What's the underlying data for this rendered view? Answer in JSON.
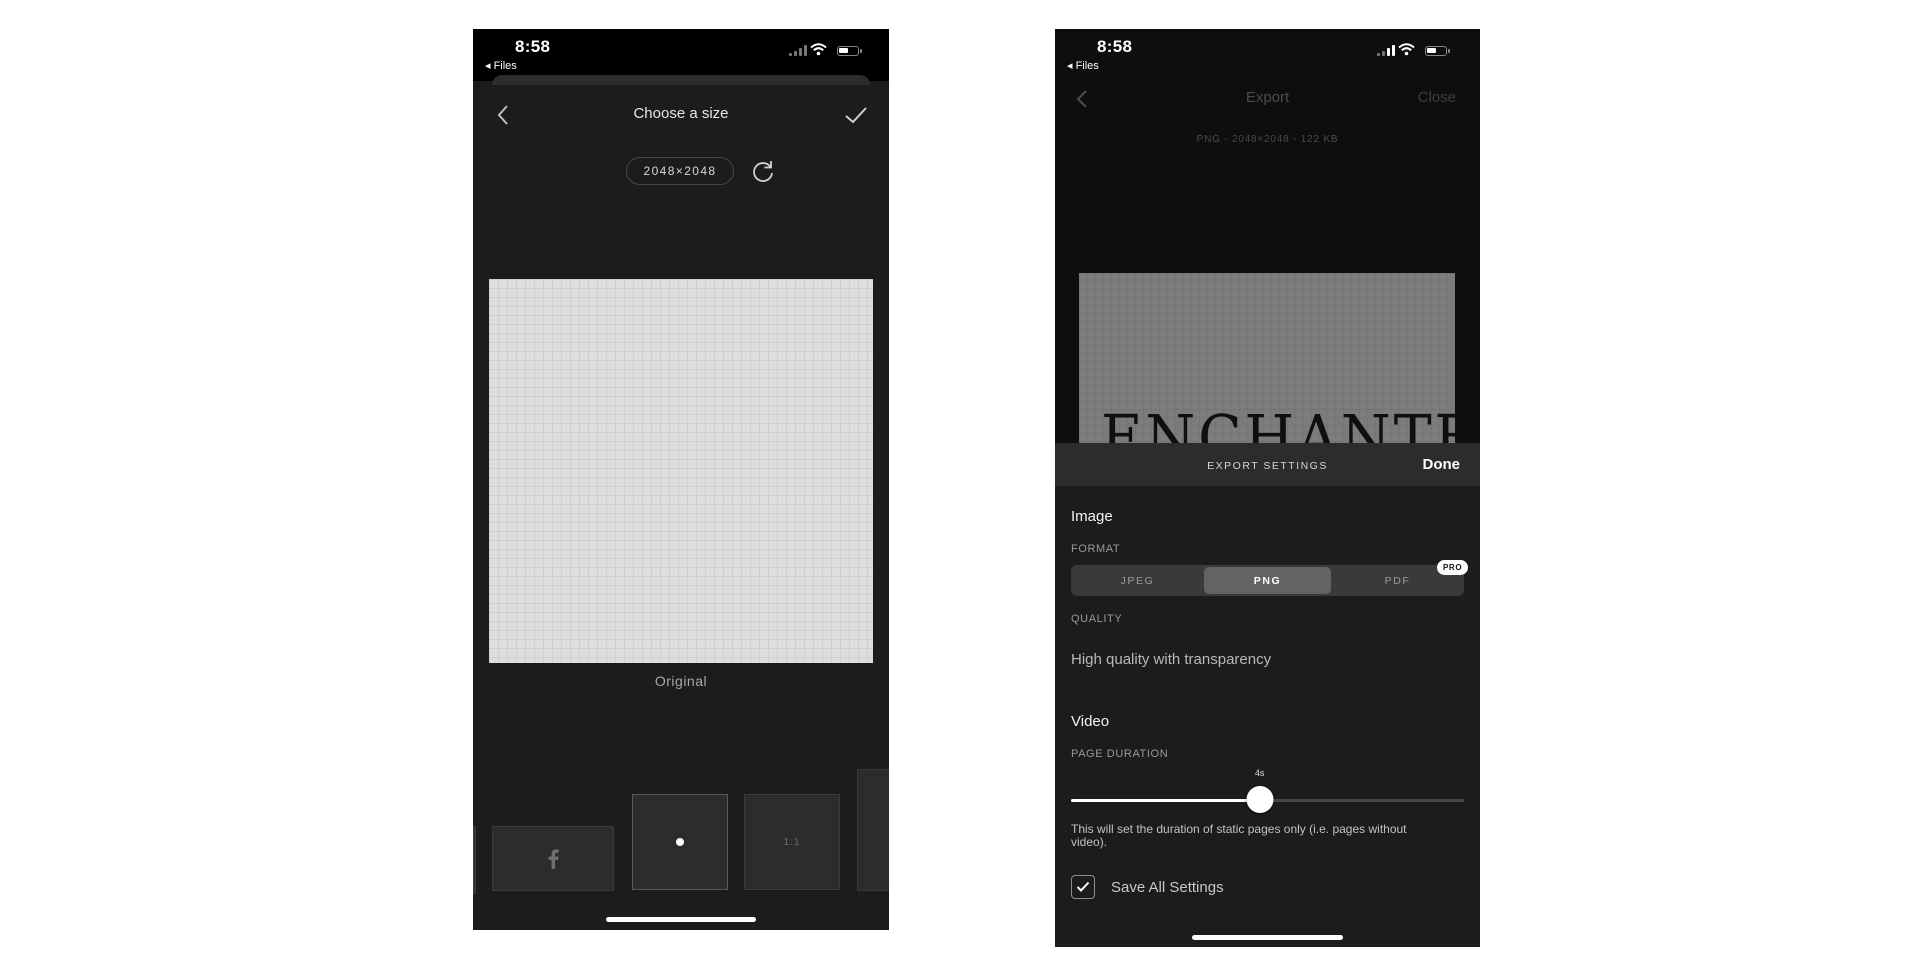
{
  "left_screen": {
    "status": {
      "time": "8:58",
      "back_app": "Files"
    },
    "header": {
      "title": "Choose a size"
    },
    "size_badge": "2048×2048",
    "canvas_label": "Original",
    "thumbnails": [
      {
        "icon": "facebook-icon"
      },
      {
        "icon": "dot-icon",
        "selected": true
      },
      {
        "label": "1:1"
      }
    ]
  },
  "right_screen": {
    "status": {
      "time": "8:58",
      "back_app": "Files"
    },
    "header": {
      "title": "Export",
      "close_label": "Close"
    },
    "file_meta": "PNG - 2048×2048 - 122 KB",
    "preview_text": "ENCHANTED",
    "settings": {
      "title": "EXPORT SETTINGS",
      "done_label": "Done",
      "image_section": "Image",
      "format_label": "FORMAT",
      "formats": [
        "JPEG",
        "PNG",
        "PDF"
      ],
      "selected_format": "PNG",
      "pro_badge": "PRO",
      "quality_label": "QUALITY",
      "quality_value": "High quality with transparency",
      "video_section": "Video",
      "duration_label": "PAGE DURATION",
      "duration_value": "4s",
      "duration_fraction": 0.48,
      "duration_help": "This will set the duration of static pages only (i.e. pages without video).",
      "save_all_label": "Save All Settings",
      "save_all_checked": true
    }
  },
  "colors": {
    "dark_bg": "#1c1c1e",
    "panel_header": "#2c2c2e",
    "accent": "#ffffff"
  }
}
